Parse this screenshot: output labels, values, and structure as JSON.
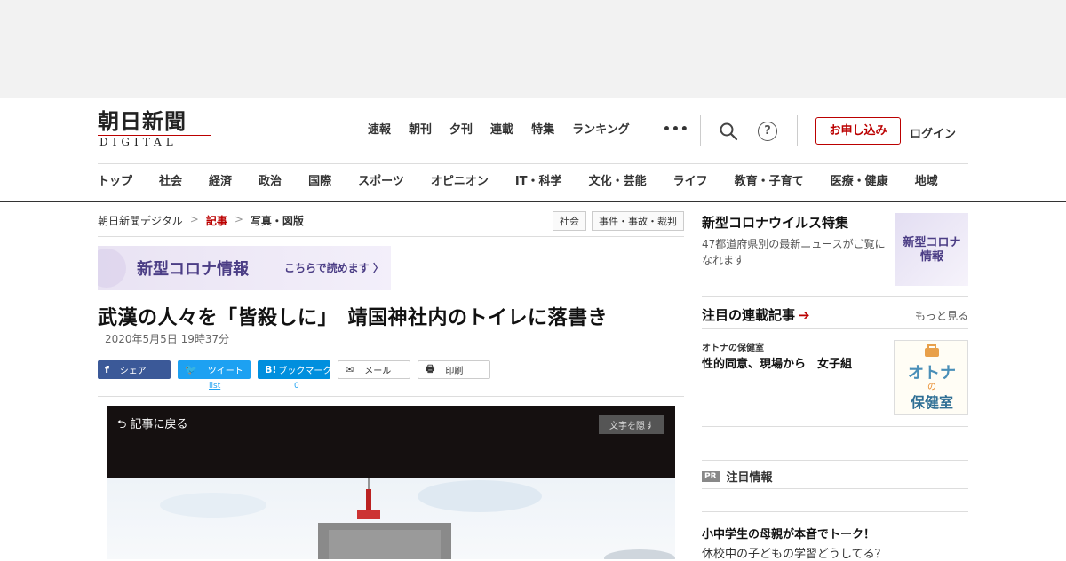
{
  "header": {
    "logo_kanji": "朝日新聞",
    "logo_sub": "DIGITAL",
    "top_nav": [
      "速報",
      "朝刊",
      "夕刊",
      "連載",
      "特集",
      "ランキング"
    ],
    "more_label": "•••",
    "subscribe_label": "お申し込み",
    "login_label": "ログイン",
    "help_label": "?",
    "categories": [
      "トップ",
      "社会",
      "経済",
      "政治",
      "国際",
      "スポーツ",
      "オピニオン",
      "IT・科学",
      "文化・芸能",
      "ライフ",
      "教育・子育て",
      "医療・健康",
      "地域"
    ]
  },
  "breadcrumb": {
    "items": [
      "朝日新聞デジタル",
      "記事",
      "写真・図版"
    ],
    "sep": ">"
  },
  "tags": [
    "社会",
    "事件・事故・裁判"
  ],
  "banner": {
    "title": "新型コロナ情報",
    "link": "こちらで読めます 〉"
  },
  "article": {
    "headline": "武漢の人々を「皆殺しに」　靖国神社内のトイレに落書き",
    "date": "2020年5月5日 19時37分"
  },
  "share": {
    "facebook": {
      "icon": "f",
      "label": "シェア"
    },
    "twitter": {
      "icon": "🐦",
      "label": "ツイート",
      "count": "list"
    },
    "hatena": {
      "icon": "B!",
      "label": "ブックマーク",
      "count": "0"
    },
    "mail": {
      "icon": "✉",
      "label": "メール"
    },
    "print": {
      "icon": "🖶",
      "label": "印刷"
    }
  },
  "photo": {
    "back_label": "記事に戻る",
    "hide_text_label": "文字を隠す"
  },
  "sidebar": {
    "feature": {
      "title": "新型コロナウイルス特集",
      "desc": "47都道府県別の最新ニュースがご覧になれます",
      "thumb_text": "新型コロナ\n情報"
    },
    "series": {
      "title": "注目の連載記事",
      "arrow": "➔",
      "more_label": "もっと見る",
      "category": "オトナの保健室",
      "item_title": "性的同意、現場から　女子組",
      "thumb_t1": "オトナ",
      "thumb_t2": "の",
      "thumb_t3": "保健室"
    },
    "pr": {
      "badge": "PR",
      "title": "注目情報",
      "head": "小中学生の母親が本音でトーク！",
      "sub": "休校中の子どもの学習どうしてる？"
    }
  }
}
